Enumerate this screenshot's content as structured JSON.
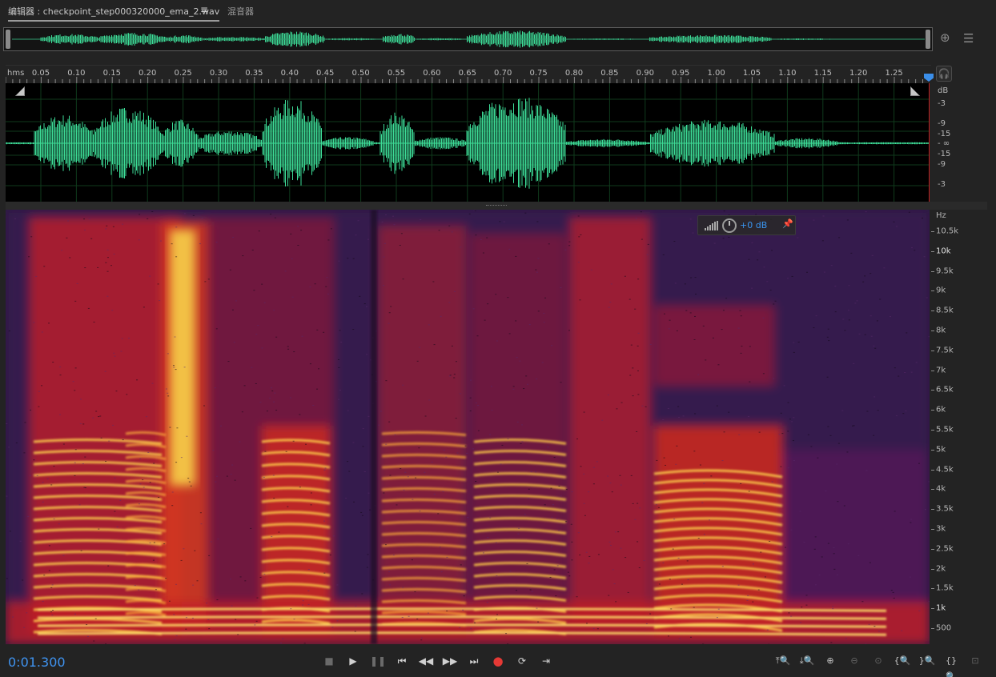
{
  "tabs": {
    "editor_label": "编辑器 : checkpoint_step000320000_ema_2.wav",
    "menu_icon": "≡",
    "mixer_label": "混音器"
  },
  "ruler": {
    "unit": "hms",
    "labels": [
      "0.05",
      "0.10",
      "0.15",
      "0.20",
      "0.25",
      "0.30",
      "0.35",
      "0.40",
      "0.45",
      "0.50",
      "0.55",
      "0.60",
      "0.65",
      "0.70",
      "0.75",
      "0.80",
      "0.85",
      "0.90",
      "0.95",
      "1.00",
      "1.05",
      "1.10",
      "1.15",
      "1.20",
      "1.25"
    ]
  },
  "db_scale": {
    "unit": "dB",
    "labels": [
      "-3",
      "-9",
      "-15",
      "- ∞",
      "-15",
      "-9",
      "-3"
    ]
  },
  "spectral_scale": {
    "unit": "Hz",
    "labels": [
      "10.5k",
      "10k",
      "9.5k",
      "9k",
      "8.5k",
      "8k",
      "7.5k",
      "7k",
      "6.5k",
      "6k",
      "5.5k",
      "5k",
      "4.5k",
      "4k",
      "3.5k",
      "3k",
      "2.5k",
      "2k",
      "1.5k",
      "1k",
      "500"
    ]
  },
  "hud": {
    "gain": "+0 dB"
  },
  "transport": {
    "timecode": "0:01.300"
  },
  "icons": {
    "stop": "stop-icon",
    "play": "play-icon",
    "pause": "pause-icon",
    "go_start": "go-to-start-icon",
    "rewind": "rewind-icon",
    "fast_forward": "fast-forward-icon",
    "go_end": "go-to-end-icon",
    "record": "record-icon",
    "loop": "loop-icon",
    "skip": "skip-selection-icon"
  },
  "colors": {
    "waveform": "#3ddc97",
    "accent": "#3f93f0",
    "record": "#e53935"
  }
}
